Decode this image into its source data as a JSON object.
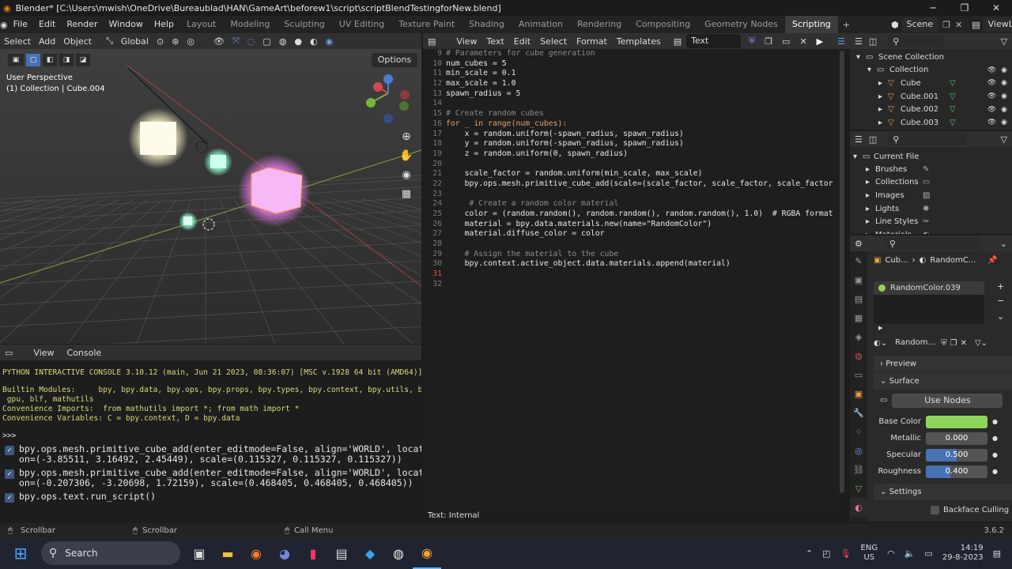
{
  "window_title": "Blender* [C:\\Users\\mwish\\OneDrive\\Bureaublad\\HAN\\GameArt\\beforew1\\script\\scriptBlendTestingforNew.blend]",
  "menu": [
    "File",
    "Edit",
    "Render",
    "Window",
    "Help"
  ],
  "workspaces": [
    "Layout",
    "Modeling",
    "Sculpting",
    "UV Editing",
    "Texture Paint",
    "Shading",
    "Animation",
    "Rendering",
    "Compositing",
    "Geometry Nodes",
    "Scripting"
  ],
  "active_workspace": "Scripting",
  "scene": "Scene",
  "view_layer": "ViewLayer",
  "viewport": {
    "header": [
      "Select",
      "Add",
      "Object"
    ],
    "transform_orientation": "Global",
    "options_label": "Options",
    "perspective_label": "User Perspective",
    "collection_label": "(1) Collection | Cube.004"
  },
  "text_editor": {
    "menus": [
      "View",
      "Text",
      "Edit",
      "Select",
      "Format",
      "Templates"
    ],
    "text_label": "Text",
    "footer": "Text: Internal",
    "lines": [
      {
        "n": "9",
        "code": "# Parameters for cube generation"
      },
      {
        "n": "10",
        "code": "num_cubes = 5"
      },
      {
        "n": "11",
        "code": "min_scale = 0.1"
      },
      {
        "n": "12",
        "code": "max_scale = 1.0"
      },
      {
        "n": "13",
        "code": "spawn_radius = 5"
      },
      {
        "n": "14",
        "code": ""
      },
      {
        "n": "15",
        "code": "# Create random cubes"
      },
      {
        "n": "16",
        "code": "for _ in range(num_cubes):"
      },
      {
        "n": "17",
        "code": "    x = random.uniform(-spawn_radius, spawn_radius)"
      },
      {
        "n": "18",
        "code": "    y = random.uniform(-spawn_radius, spawn_radius)"
      },
      {
        "n": "19",
        "code": "    z = random.uniform(0, spawn_radius)"
      },
      {
        "n": "20",
        "code": ""
      },
      {
        "n": "21",
        "code": "    scale_factor = random.uniform(min_scale, max_scale)"
      },
      {
        "n": "22",
        "code": "    bpy.ops.mesh.primitive_cube_add(scale=(scale_factor, scale_factor, scale_factor"
      },
      {
        "n": "23",
        "code": ""
      },
      {
        "n": "24",
        "code": "     # Create a random color material"
      },
      {
        "n": "25",
        "code": "    color = (random.random(), random.random(), random.random(), 1.0)  # RGBA format"
      },
      {
        "n": "26",
        "code": "    material = bpy.data.materials.new(name=\"RandomColor\")"
      },
      {
        "n": "27",
        "code": "    material.diffuse_color = color"
      },
      {
        "n": "28",
        "code": ""
      },
      {
        "n": "29",
        "code": "    # Assign the material to the cube"
      },
      {
        "n": "30",
        "code": "    bpy.context.active_object.data.materials.append(material)"
      },
      {
        "n": "31",
        "code": "    "
      },
      {
        "n": "32",
        "code": ""
      }
    ]
  },
  "console": {
    "menus": [
      "View",
      "Console"
    ],
    "banner": "PYTHON INTERACTIVE CONSOLE 3.10.12 (main, Jun 21 2023, 08:36:07) [MSC v.1928 64 bit (AMD64)]",
    "builtin_label": "Builtin Modules:",
    "builtin_value": "bpy, bpy.data, bpy.ops, bpy.props, bpy.types, bpy.context, bpy.utils, bgl,",
    "builtin_value2": " gpu, blf, mathutils",
    "imports_label": "Convenience Imports:",
    "imports_value": "from mathutils import *; from math import *",
    "vars_label": "Convenience Variables:",
    "vars_value": "C = bpy.context, D = bpy.data",
    "prompt": ">>> ",
    "ops": [
      "bpy.ops.mesh.primitive_cube_add(enter_editmode=False, align='WORLD', locati\non=(-3.85511, 3.16492, 2.45449), scale=(0.115327, 0.115327, 0.115327))",
      "bpy.ops.mesh.primitive_cube_add(enter_editmode=False, align='WORLD', locati\non=(-0.207306, -3.20698, 1.72159), scale=(0.468405, 0.468405, 0.468405))",
      "bpy.ops.text.run_script()"
    ]
  },
  "outliner": {
    "items": [
      {
        "label": "Scene Collection",
        "depth": 0
      },
      {
        "label": "Collection",
        "depth": 1
      },
      {
        "label": "Cube",
        "depth": 2
      },
      {
        "label": "Cube.001",
        "depth": 2
      },
      {
        "label": "Cube.002",
        "depth": 2
      },
      {
        "label": "Cube.003",
        "depth": 2
      }
    ]
  },
  "blend_file": {
    "root": "Current File",
    "items": [
      "Brushes",
      "Collections",
      "Images",
      "Lights",
      "Line Styles",
      "Materials"
    ]
  },
  "properties": {
    "breadcrumb_obj": "Cub...",
    "breadcrumb_mat": "RandomC...",
    "slot": "RandomColor.039",
    "material_name": "Random...",
    "preview": "Preview",
    "surface": "Surface",
    "use_nodes": "Use Nodes",
    "base_color_label": "Base Color",
    "base_color": "#8fd45a",
    "metallic_label": "Metallic",
    "metallic": "0.000",
    "metallic_frac": 0,
    "specular_label": "Specular",
    "specular": "0.500",
    "specular_frac": 0.5,
    "roughness_label": "Roughness",
    "roughness": "0.400",
    "roughness_frac": 0.4,
    "settings": "Settings",
    "backface": "Backface Culling"
  },
  "statusbar": {
    "left": "Scrollbar",
    "mid": "Scrollbar",
    "right": "Call Menu",
    "version": "3.6.2"
  },
  "taskbar": {
    "search": "Search",
    "lang1": "ENG",
    "lang2": "US",
    "time": "14:19",
    "date": "29-8-2023"
  }
}
